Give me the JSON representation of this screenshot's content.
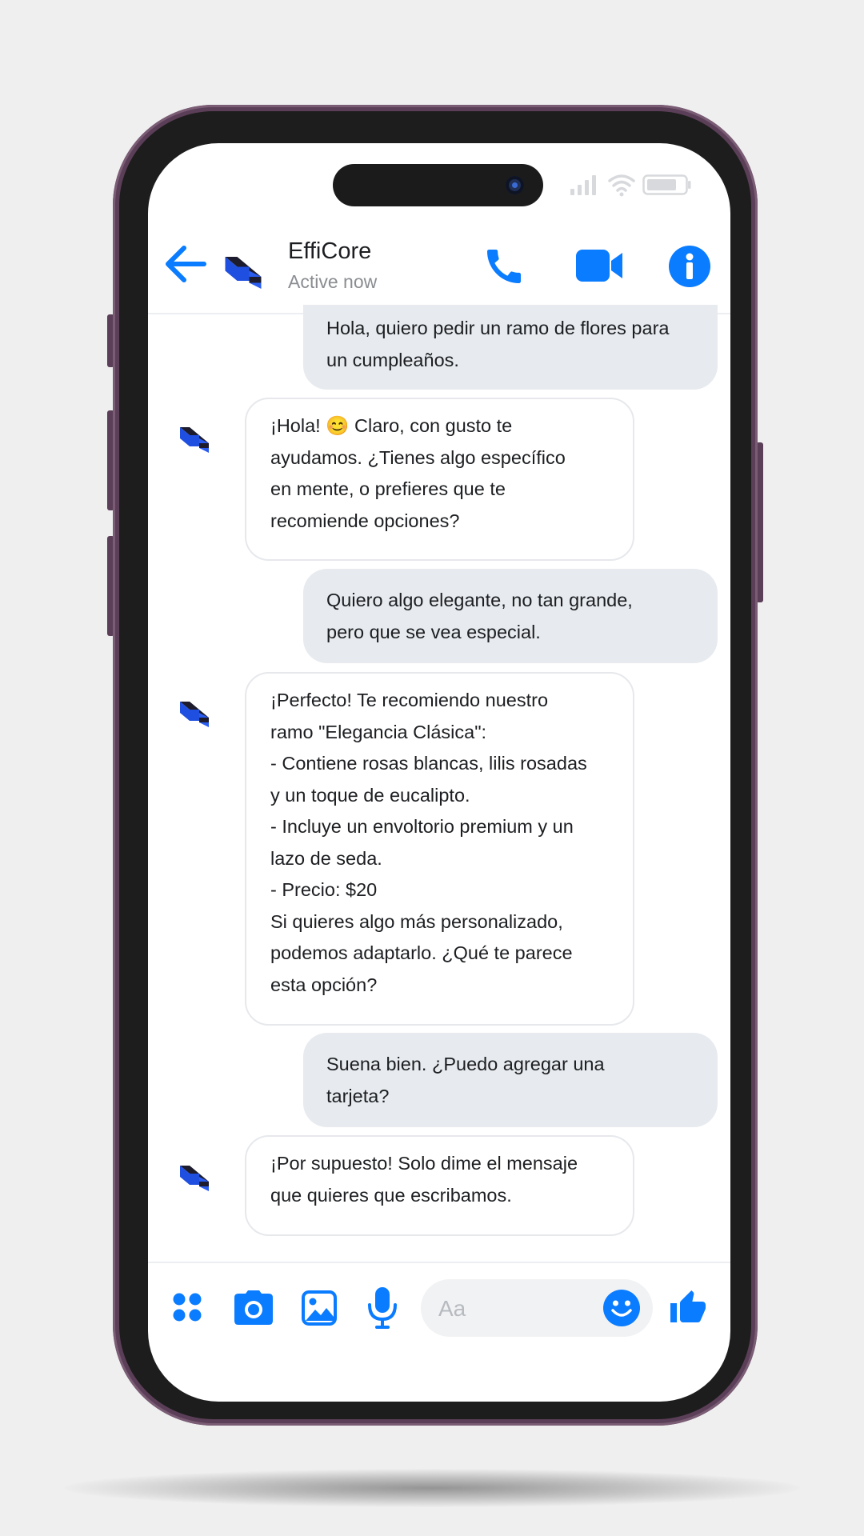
{
  "header": {
    "contact_name": "EffiCore",
    "presence": "Active now",
    "icons": [
      "back-arrow-icon",
      "efficore-logo",
      "phone-icon",
      "video-camera-icon",
      "info-icon"
    ]
  },
  "status_bar": {
    "icons": [
      "signal-icon",
      "wifi-icon",
      "battery-icon"
    ]
  },
  "messages": [
    {
      "sender": "user",
      "lines": [
        "Hola, quiero pedir un ramo de flores para",
        "un cumpleaños."
      ]
    },
    {
      "sender": "bot",
      "lines": [
        "¡Hola! 😊 Claro, con gusto te",
        "ayudamos. ¿Tienes algo específico",
        "en mente, o prefieres que te",
        "recomiende opciones?"
      ]
    },
    {
      "sender": "user",
      "lines": [
        "Quiero algo elegante, no tan grande,",
        "pero que se vea especial."
      ]
    },
    {
      "sender": "bot",
      "lines": [
        "¡Perfecto! Te recomiendo nuestro",
        "ramo \"Elegancia Clásica\":",
        "- Contiene rosas blancas, lilis rosadas",
        "y un toque de eucalipto.",
        "- Incluye un envoltorio premium y un",
        "lazo de seda.",
        "- Precio: $20",
        "Si quieres algo más personalizado,",
        "podemos adaptarlo. ¿Qué te parece",
        "esta opción?"
      ]
    },
    {
      "sender": "user",
      "lines": [
        "Suena bien. ¿Puedo agregar una",
        "tarjeta?"
      ]
    },
    {
      "sender": "bot",
      "lines": [
        "¡Por supuesto! Solo dime el mensaje",
        "que quieres que escribamos."
      ]
    }
  ],
  "composer": {
    "placeholder": "Aa",
    "value": "",
    "icons": [
      "apps-icon",
      "camera-icon",
      "image-icon",
      "microphone-icon",
      "emoji-icon",
      "thumbs-up-icon"
    ]
  },
  "colors": {
    "accent": "#0a7cff",
    "outgoing_bubble": "#e7eaee",
    "incoming_bubble": "#ffffff",
    "phone_frame": "#5b3e57",
    "logo_blue": "#1f4fe0"
  }
}
